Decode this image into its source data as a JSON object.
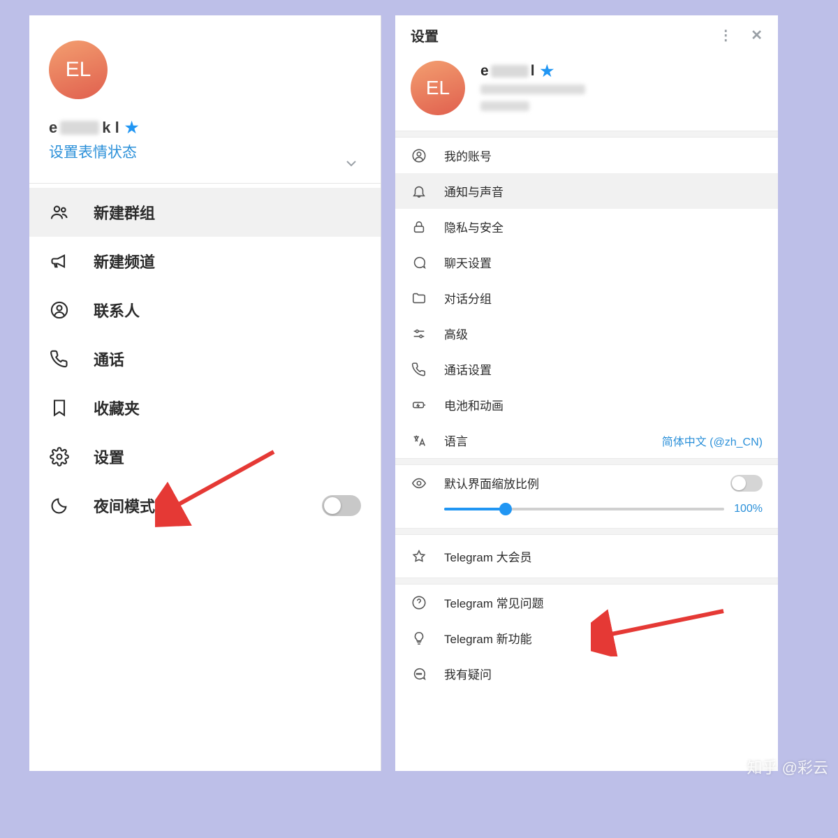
{
  "left": {
    "avatar_initials": "EL",
    "username_prefix": "e",
    "username_suffix": "k l",
    "emoji_status": "设置表情状态",
    "menu": [
      {
        "id": "new-group",
        "label": "新建群组",
        "selected": true
      },
      {
        "id": "new-channel",
        "label": "新建频道"
      },
      {
        "id": "contacts",
        "label": "联系人"
      },
      {
        "id": "calls",
        "label": "通话"
      },
      {
        "id": "saved",
        "label": "收藏夹"
      },
      {
        "id": "settings",
        "label": "设置"
      },
      {
        "id": "night",
        "label": "夜间模式",
        "toggle": false
      }
    ]
  },
  "right": {
    "title": "设置",
    "avatar_initials": "EL",
    "username_prefix": "e",
    "username_suffix": "l",
    "section1": [
      {
        "id": "account",
        "label": "我的账号"
      },
      {
        "id": "notifications",
        "label": "通知与声音",
        "selected": true
      },
      {
        "id": "privacy",
        "label": "隐私与安全"
      },
      {
        "id": "chat",
        "label": "聊天设置"
      },
      {
        "id": "folders",
        "label": "对话分组"
      },
      {
        "id": "advanced",
        "label": "高级"
      },
      {
        "id": "call-settings",
        "label": "通话设置"
      },
      {
        "id": "battery",
        "label": "电池和动画"
      },
      {
        "id": "language",
        "label": "语言",
        "right": "简体中文 (@zh_CN)"
      }
    ],
    "scale": {
      "label": "默认界面缩放比例",
      "value": "100%",
      "toggle": false
    },
    "section_premium": {
      "label": "Telegram 大会员"
    },
    "section3": [
      {
        "id": "faq",
        "label": "Telegram 常见问题"
      },
      {
        "id": "features",
        "label": "Telegram 新功能"
      },
      {
        "id": "ask",
        "label": "我有疑问"
      }
    ]
  },
  "watermark": "知乎 @彩云"
}
